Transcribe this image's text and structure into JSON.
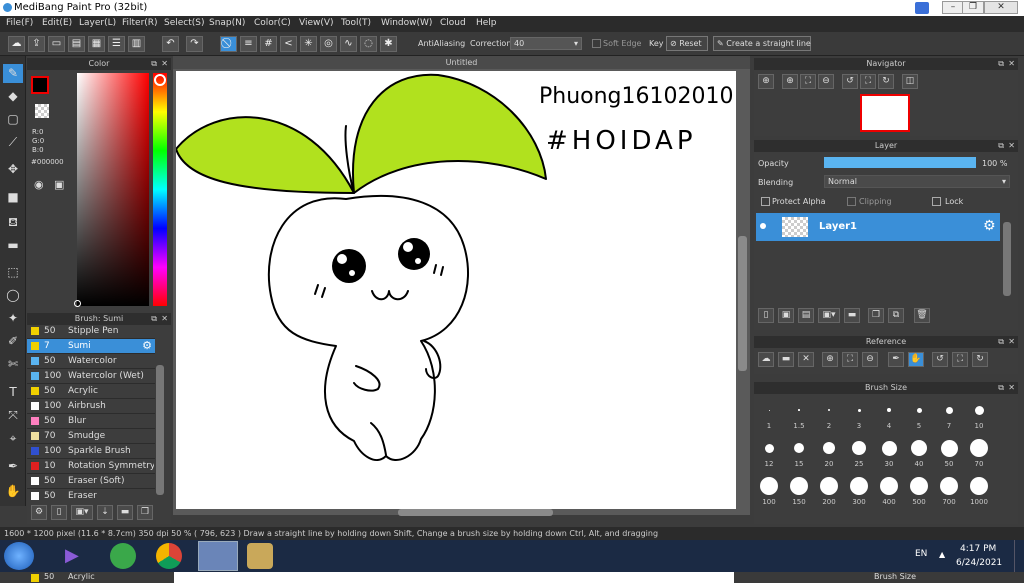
{
  "window": {
    "title": "MediBang Paint Pro (32bit)"
  },
  "menu": [
    "File(F)",
    "Edit(E)",
    "Layer(L)",
    "Filter(R)",
    "Select(S)",
    "Snap(N)",
    "Color(C)",
    "View(V)",
    "Tool(T)",
    "Window(W)",
    "Cloud",
    "Help"
  ],
  "toolbar": {
    "antialiasing_label": "AntiAliasing",
    "correction_label": "Correction",
    "correction_value": "40",
    "soft_edge_label": "Soft Edge",
    "key_label": "Key",
    "reset_label": "Reset",
    "straight_line_label": "Create a straight line"
  },
  "color_panel": {
    "title": "Color",
    "r": "R:0",
    "g": "G:0",
    "b": "B:0",
    "hex": "#000000",
    "current_color": "#000000"
  },
  "canvas": {
    "tab_title": "Untitled",
    "handwriting_line1": "Phuong16102010",
    "handwriting_line2": "#HOIDAP"
  },
  "brush_panel": {
    "title": "Brush: Sumi",
    "items": [
      {
        "size": "50",
        "name": "Stipple Pen",
        "color": "#f0d000"
      },
      {
        "size": "7",
        "name": "Sumi",
        "color": "#f0d000"
      },
      {
        "size": "50",
        "name": "Watercolor",
        "color": "#5ab4f0"
      },
      {
        "size": "100",
        "name": "Watercolor (Wet)",
        "color": "#5ab4f0"
      },
      {
        "size": "50",
        "name": "Acrylic",
        "color": "#f0d000"
      },
      {
        "size": "100",
        "name": "Airbrush",
        "color": "#ffffff"
      },
      {
        "size": "50",
        "name": "Blur",
        "color": "#ff80c0"
      },
      {
        "size": "70",
        "name": "Smudge",
        "color": "#f0e0a0"
      },
      {
        "size": "100",
        "name": "Sparkle Brush",
        "color": "#3050d0"
      },
      {
        "size": "10",
        "name": "Rotation Symmetry Pen",
        "color": "#e02020"
      },
      {
        "size": "50",
        "name": "Eraser (Soft)",
        "color": "#ffffff"
      },
      {
        "size": "50",
        "name": "Eraser",
        "color": "#ffffff"
      }
    ],
    "below_item": {
      "size": "50",
      "name": "Acrylic",
      "color": "#f0d000"
    }
  },
  "navigator": {
    "title": "Navigator"
  },
  "layer_panel": {
    "title": "Layer",
    "opacity_label": "Opacity",
    "opacity_value": "100 %",
    "opacity": 1.0,
    "blending_label": "Blending",
    "blending_value": "Normal",
    "protect_alpha": "Protect Alpha",
    "clipping": "Clipping",
    "lock": "Lock",
    "layer_name": "Layer1"
  },
  "reference_panel": {
    "title": "Reference"
  },
  "brush_size_panel": {
    "title": "Brush Size",
    "labels": [
      "1",
      "1.5",
      "2",
      "3",
      "4",
      "5",
      "7",
      "10",
      "12",
      "15",
      "20",
      "25",
      "30",
      "40",
      "50",
      "70",
      "100",
      "150",
      "200",
      "300",
      "400",
      "500",
      "700",
      "1000"
    ],
    "bottom_title": "Brush Size"
  },
  "status": {
    "text": "1600 * 1200 pixel   (11.6 * 8.7cm)   350 dpi   50 %   ( 796, 623 )   Draw a straight line by holding down Shift, Change a brush size by holding down Ctrl, Alt, and dragging"
  },
  "taskbar": {
    "lang": "EN",
    "time": "4:17 PM",
    "date": "6/24/2021"
  }
}
